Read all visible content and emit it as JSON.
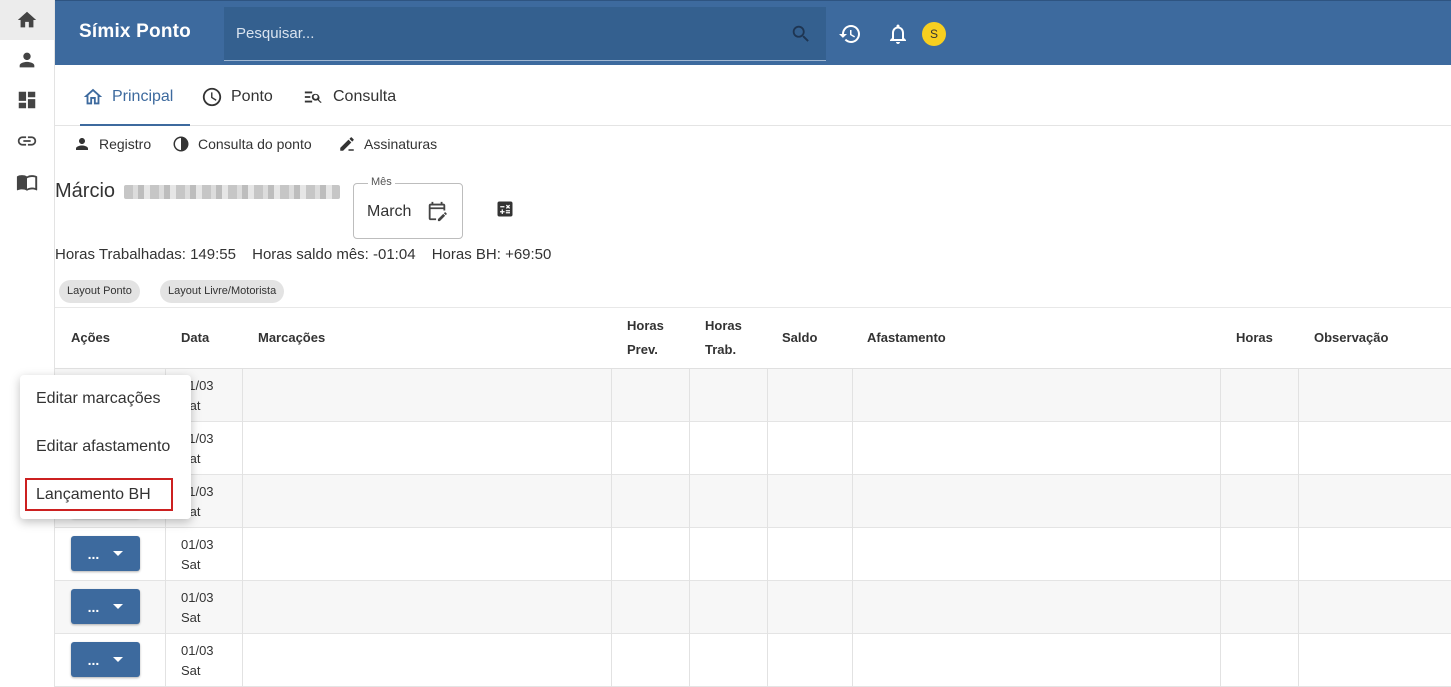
{
  "app": {
    "title": "Símix Ponto"
  },
  "search": {
    "placeholder": "Pesquisar..."
  },
  "user": {
    "avatar_initial": "S"
  },
  "tabs": [
    {
      "label": "Principal",
      "active": true
    },
    {
      "label": "Ponto",
      "active": false
    },
    {
      "label": "Consulta",
      "active": false
    }
  ],
  "subnav": [
    {
      "label": "Registro"
    },
    {
      "label": "Consulta do ponto"
    },
    {
      "label": "Assinaturas"
    }
  ],
  "employee": {
    "first_name": "Márcio"
  },
  "month_field": {
    "label": "Mês",
    "value": "March"
  },
  "hours": {
    "worked": "Horas Trabalhadas: 149:55",
    "balance_month": "Horas saldo mês: -01:04",
    "bank": "Horas BH: +69:50"
  },
  "chips": [
    {
      "label": "Layout Ponto"
    },
    {
      "label": "Layout Livre/Motorista"
    }
  ],
  "table": {
    "headers": {
      "acoes": "Ações",
      "data": "Data",
      "marcacoes": "Marcações",
      "horas_prev_1": "Horas",
      "horas_prev_2": "Prev.",
      "horas_trab_1": "Horas",
      "horas_trab_2": "Trab.",
      "saldo": "Saldo",
      "afastamento": "Afastamento",
      "horas": "Horas",
      "observacao": "Observação"
    },
    "action_button_label": "...",
    "rows": [
      {
        "date": "01/03",
        "weekday": "Sat"
      },
      {
        "date": "01/03",
        "weekday": "Sat"
      },
      {
        "date": "01/03",
        "weekday": "Sat"
      },
      {
        "date": "01/03",
        "weekday": "Sat"
      },
      {
        "date": "01/03",
        "weekday": "Sat"
      },
      {
        "date": "01/03",
        "weekday": "Sat"
      }
    ]
  },
  "action_menu": {
    "items": [
      {
        "label": "Editar marcações"
      },
      {
        "label": "Editar afastamento"
      },
      {
        "label": "Lançamento BH",
        "highlighted": true
      }
    ]
  },
  "colors": {
    "primary": "#3d6a9e",
    "avatar": "#f7cf20",
    "highlight_border": "#cc2020"
  }
}
